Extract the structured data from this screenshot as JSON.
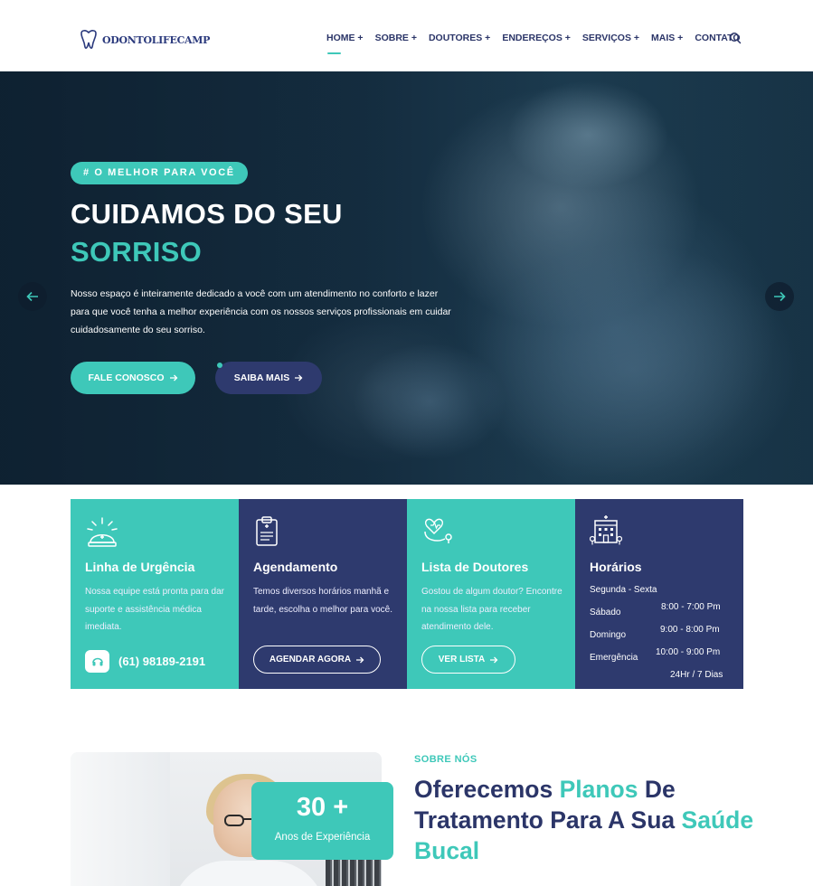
{
  "header": {
    "logo_text": "ODONTOLIFECAMP",
    "nav": [
      {
        "label": "HOME +"
      },
      {
        "label": "SOBRE +"
      },
      {
        "label": "DOUTORES +"
      },
      {
        "label": "ENDEREÇOS +"
      },
      {
        "label": "SERVIÇOS +"
      },
      {
        "label": "MAIS +"
      },
      {
        "label": "CONTATO"
      }
    ],
    "search_icon": "search-icon"
  },
  "hero": {
    "tag": "# O MELHOR PARA VOCÊ",
    "title_line1": "CUIDAMOS DO SEU",
    "title_line2": "SORRISO",
    "description": "Nosso espaço é inteiramente dedicado a você com um atendimento no conforto e lazer para que você tenha a melhor experiência com os nossos serviços profissionais em cuidar cuidadosamente do seu sorriso.",
    "btn_primary": "FALE CONOSCO",
    "btn_secondary": "SAIBA MAIS",
    "prev_icon": "arrow-left-icon",
    "next_icon": "arrow-right-icon"
  },
  "cards": {
    "urgencia": {
      "title": "Linha de Urgência",
      "text": "Nossa equipe está pronta para dar suporte e assistência médica imediata.",
      "phone": "(61) 98189-2191",
      "icon": "siren-icon"
    },
    "agendamento": {
      "title": "Agendamento",
      "text": "Temos diversos horários manhã e tarde, escolha o melhor para você.",
      "button": "AGENDAR AGORA",
      "icon": "clipboard-icon"
    },
    "doutores": {
      "title": "Lista de Doutores",
      "text": "Gostou de algum doutor? Encontre na nossa lista para receber atendimento dele.",
      "button": "VER LISTA",
      "icon": "stethoscope-heart-icon"
    },
    "horarios": {
      "title": "Horários",
      "weekdays": "Segunda - Sexta",
      "sabado": "Sábado",
      "domingo": "Domingo",
      "emergencia": "Emergência",
      "t1": "8:00 - 7:00 Pm",
      "t2": "9:00 - 8:00 Pm",
      "t3": "10:00 - 9:00 Pm",
      "t4": "24Hr / 7 Dias",
      "icon": "hospital-icon"
    }
  },
  "about": {
    "experience_number": "30 +",
    "experience_label": "Anos de Experiência",
    "tag": "SOBRE NÓS",
    "title_a": "Oferecemos ",
    "title_b": "Planos",
    "title_c": " De Tratamento Para A Sua ",
    "title_d": "Saúde Bucal"
  },
  "colors": {
    "teal": "#3ec8b9",
    "navy": "#2e3a6e",
    "heading": "#2b3568"
  }
}
